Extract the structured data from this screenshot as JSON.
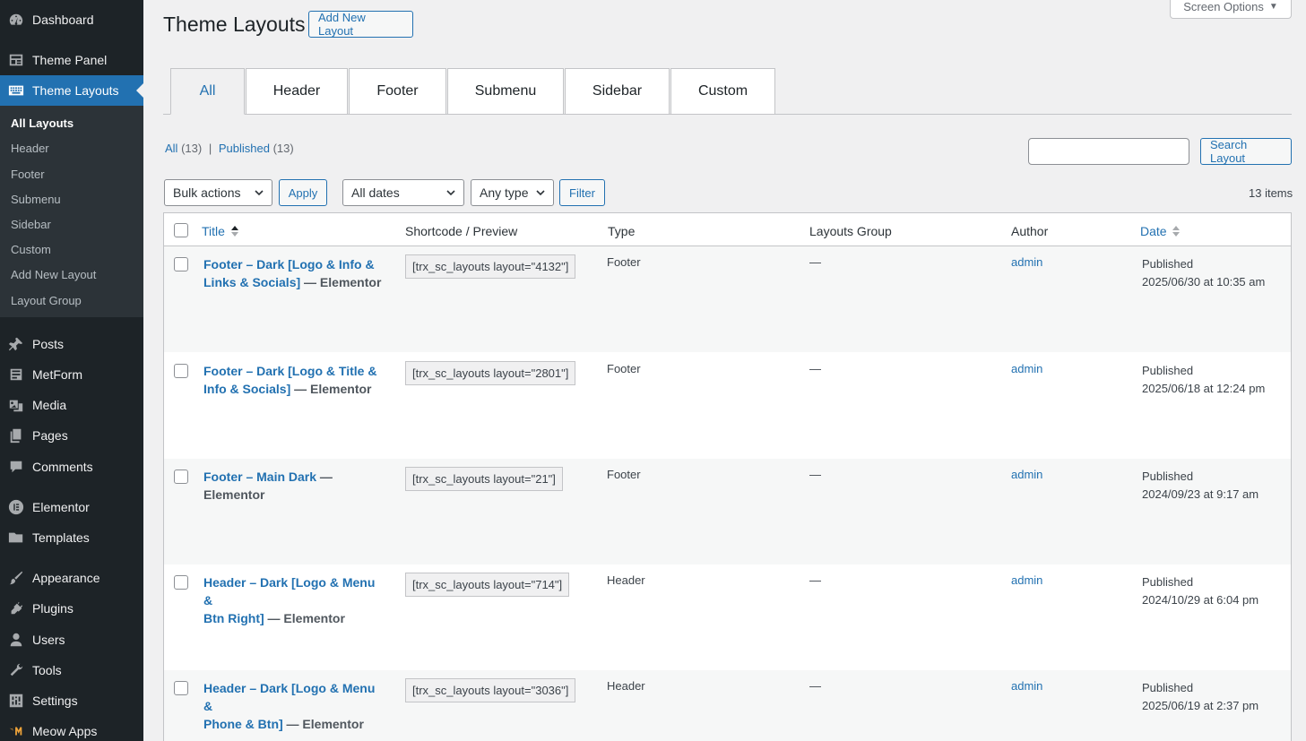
{
  "sidebar": {
    "items": [
      {
        "label": "Dashboard",
        "icon": "dashboard-icon"
      },
      {
        "label": "Theme Panel",
        "icon": "theme-panel-icon"
      },
      {
        "label": "Theme Layouts",
        "icon": "theme-layouts-icon",
        "current": true
      },
      {
        "label": "Posts",
        "icon": "pin-icon"
      },
      {
        "label": "MetForm",
        "icon": "metform-icon"
      },
      {
        "label": "Media",
        "icon": "media-icon"
      },
      {
        "label": "Pages",
        "icon": "pages-icon"
      },
      {
        "label": "Comments",
        "icon": "comments-icon"
      },
      {
        "label": "Elementor",
        "icon": "elementor-icon"
      },
      {
        "label": "Templates",
        "icon": "folder-icon"
      },
      {
        "label": "Appearance",
        "icon": "brush-icon"
      },
      {
        "label": "Plugins",
        "icon": "plugin-icon"
      },
      {
        "label": "Users",
        "icon": "users-icon"
      },
      {
        "label": "Tools",
        "icon": "wrench-icon"
      },
      {
        "label": "Settings",
        "icon": "settings-icon"
      },
      {
        "label": "Meow Apps",
        "icon": "meow-icon"
      }
    ],
    "submenu": [
      "All Layouts",
      "Header",
      "Footer",
      "Submenu",
      "Sidebar",
      "Custom",
      "Add New Layout",
      "Layout Group"
    ]
  },
  "header": {
    "title": "Theme Layouts",
    "add_new": "Add New Layout",
    "screen_options": "Screen Options"
  },
  "tabs": [
    "All",
    "Header",
    "Footer",
    "Submenu",
    "Sidebar",
    "Custom"
  ],
  "status": {
    "all_label": "All",
    "all_count": "(13)",
    "separator": "|",
    "published_label": "Published",
    "published_count": "(13)"
  },
  "search": {
    "button": "Search Layout",
    "value": ""
  },
  "filters": {
    "bulk_actions": "Bulk actions",
    "apply": "Apply",
    "dates": "All dates",
    "type": "Any type",
    "filter": "Filter",
    "items_count": "13 items"
  },
  "table": {
    "columns": [
      "Title",
      "Shortcode / Preview",
      "Type",
      "Layouts Group",
      "Author",
      "Date"
    ],
    "rows": [
      {
        "title_line1": "Footer – Dark [Logo & Info &",
        "title_line2": "Links & Socials]",
        "suffix": "— Elementor",
        "shortcode": "[trx_sc_layouts layout=\"4132\"]",
        "type": "Footer",
        "group": "—",
        "author": "admin",
        "status": "Published",
        "date": "2025/06/30 at 10:35 am"
      },
      {
        "title_line1": "Footer – Dark [Logo & Title &",
        "title_line2": "Info & Socials]",
        "suffix": "— Elementor",
        "shortcode": "[trx_sc_layouts layout=\"2801\"]",
        "type": "Footer",
        "group": "—",
        "author": "admin",
        "status": "Published",
        "date": "2025/06/18 at 12:24 pm"
      },
      {
        "title_line1": "Footer – Main Dark",
        "title_line2": "",
        "suffix": "— Elementor",
        "shortcode": "[trx_sc_layouts layout=\"21\"]",
        "type": "Footer",
        "group": "—",
        "author": "admin",
        "status": "Published",
        "date": "2024/09/23 at 9:17 am"
      },
      {
        "title_line1": "Header – Dark [Logo & Menu &",
        "title_line2": "Btn Right]",
        "suffix": "— Elementor",
        "shortcode": "[trx_sc_layouts layout=\"714\"]",
        "type": "Header",
        "group": "—",
        "author": "admin",
        "status": "Published",
        "date": "2024/10/29 at 6:04 pm"
      },
      {
        "title_line1": "Header – Dark [Logo & Menu &",
        "title_line2": "Phone & Btn]",
        "suffix": "— Elementor",
        "shortcode": "[trx_sc_layouts layout=\"3036\"]",
        "type": "Header",
        "group": "—",
        "author": "admin",
        "status": "Published",
        "date": "2025/06/19 at 2:37 pm"
      }
    ]
  },
  "colors": {
    "accent": "#2271b1",
    "sidebar_bg": "#1d2327",
    "submenu_bg": "#2c3338",
    "page_bg": "#f0f0f1"
  }
}
